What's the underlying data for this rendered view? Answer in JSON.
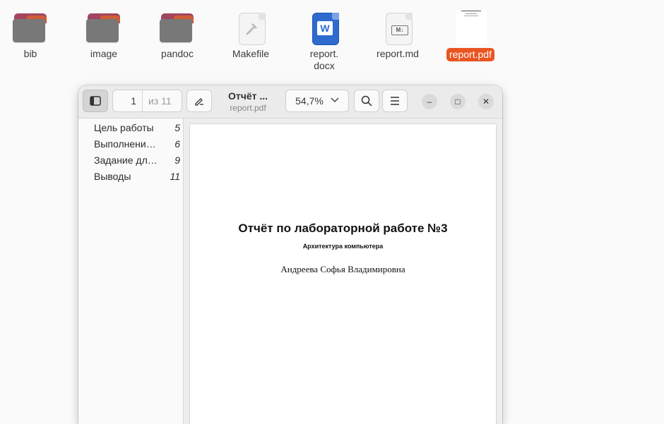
{
  "desktop": {
    "files": [
      {
        "name": "bib",
        "type": "folder"
      },
      {
        "name": "image",
        "type": "folder"
      },
      {
        "name": "pandoc",
        "type": "folder"
      },
      {
        "name": "Makefile",
        "type": "text-file"
      },
      {
        "name": "report.\ndocx",
        "type": "word-document"
      },
      {
        "name": "report.md",
        "type": "markdown-file"
      },
      {
        "name": "report.pdf",
        "type": "pdf",
        "selected": true
      }
    ]
  },
  "window": {
    "toolbar": {
      "sidebar_toggle_icon": "sidebar-icon",
      "page_current": "1",
      "page_total": "из 11",
      "annotate_icon": "pencil-icon",
      "doc_title": "Отчёт ...",
      "doc_filename": "report.pdf",
      "zoom": "54,7%",
      "search_icon": "search-icon",
      "menu_icon": "hamburger-icon",
      "minimize": "–",
      "maximize": "□",
      "close": "✕"
    },
    "outline": [
      {
        "label": "Цель работы",
        "page": "5"
      },
      {
        "label": "Выполнени…",
        "page": "6"
      },
      {
        "label": "Задание дл…",
        "page": "9"
      },
      {
        "label": "Выводы",
        "page": "11"
      }
    ],
    "page": {
      "title": "Отчёт по лабораторной работе №3",
      "subtitle": "Архитектура компьютера",
      "author": "Андреева Софья Владимировна"
    }
  },
  "colors": {
    "accent": "#e95420",
    "folder_body": "#787878",
    "folder_tab": "#a3455f",
    "word_blue": "#2f6bcf"
  }
}
